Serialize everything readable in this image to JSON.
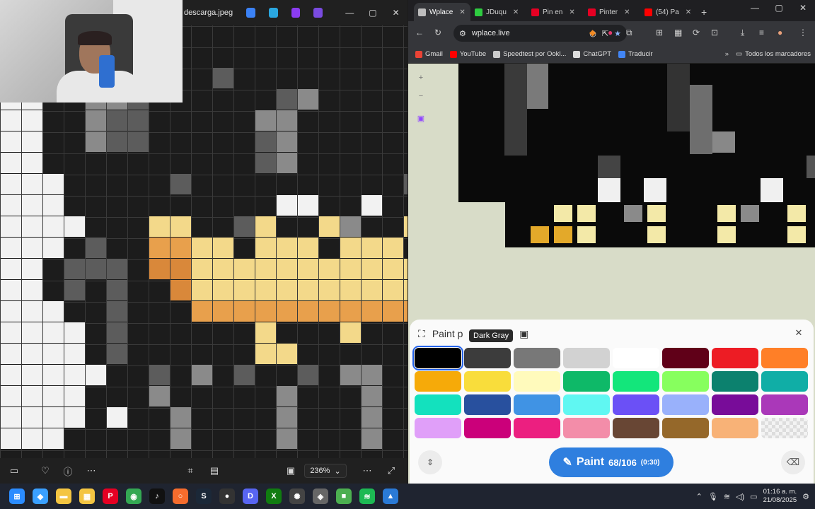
{
  "viewer": {
    "filename": "descarga.jpeg",
    "zoom": "236%",
    "toolbar_icons": [
      "film-icon",
      "heart-icon",
      "info-icon",
      "more-icon",
      "crop-icon",
      "adjust-icon",
      "fit-icon",
      "more-icon-2",
      "fullscreen-icon"
    ]
  },
  "browser": {
    "tabs": [
      {
        "label": "Wplace",
        "color": "#bdbdbd",
        "active": true
      },
      {
        "label": "JDuqu",
        "color": "#2ecc40",
        "active": false
      },
      {
        "label": "Pin en",
        "color": "#e60023",
        "active": false
      },
      {
        "label": "Pinter",
        "color": "#e60023",
        "active": false
      },
      {
        "label": "(54) Pa",
        "color": "#ff0000",
        "active": false
      }
    ],
    "url": "wplace.live",
    "bookmarks": [
      {
        "label": "Gmail",
        "color": "#ea4335"
      },
      {
        "label": "YouTube",
        "color": "#ff0000"
      },
      {
        "label": "Speedtest por Ookl...",
        "color": "#cccccc"
      },
      {
        "label": "ChatGPT",
        "color": "#dddddd"
      },
      {
        "label": "Traducir",
        "color": "#4285f4"
      }
    ],
    "bookmarks_folder": "Todos los marcadores"
  },
  "palette_panel": {
    "title": "Paint p",
    "tooltip": "Dark Gray",
    "colors": [
      "#000000",
      "#3c3c3c",
      "#787878",
      "#d2d2d2",
      "#ffffff",
      "#600018",
      "#ed1c24",
      "#ff7f27",
      "#f6aa09",
      "#f9dd3b",
      "#fffabc",
      "#0eb968",
      "#13e67b",
      "#87ff5e",
      "#0c816e",
      "#10aea6",
      "#13e1be",
      "#28509e",
      "#4093e4",
      "#60f7f2",
      "#6b50f6",
      "#99b1fb",
      "#780c99",
      "#aa38b9",
      "#e09ff9",
      "#cb007a",
      "#ec1f80",
      "#f38da9",
      "#684634",
      "#95682a",
      "#f8b277",
      "transparent"
    ],
    "selected_index": 0,
    "paint_label": "Paint",
    "paint_count": "68/106",
    "paint_time": "(0:30)"
  },
  "taskbar": {
    "apps": [
      {
        "name": "windows-start-icon",
        "color": "#2b8cff",
        "glyph": "⊞"
      },
      {
        "name": "copilot-icon",
        "color": "#3aa0ff",
        "glyph": "◆"
      },
      {
        "name": "file-explorer-icon",
        "color": "#f4c542",
        "glyph": "▬"
      },
      {
        "name": "store-icon",
        "color": "#f4c542",
        "glyph": "▦"
      },
      {
        "name": "pinterest-icon",
        "color": "#e60023",
        "glyph": "P"
      },
      {
        "name": "chrome-icon",
        "color": "#34a853",
        "glyph": "◉"
      },
      {
        "name": "tiktok-icon",
        "color": "#111111",
        "glyph": "♪"
      },
      {
        "name": "origin-icon",
        "color": "#f56c2d",
        "glyph": "○"
      },
      {
        "name": "steam-icon",
        "color": "#1b2838",
        "glyph": "S"
      },
      {
        "name": "obs-icon",
        "color": "#333333",
        "glyph": "●"
      },
      {
        "name": "discord-icon",
        "color": "#5865f2",
        "glyph": "D"
      },
      {
        "name": "xbox-icon",
        "color": "#107c10",
        "glyph": "X"
      },
      {
        "name": "chatgpt-icon",
        "color": "#444444",
        "glyph": "✺"
      },
      {
        "name": "vpn-icon",
        "color": "#666666",
        "glyph": "◈"
      },
      {
        "name": "minecraft-icon",
        "color": "#4caf50",
        "glyph": "■"
      },
      {
        "name": "spotify-icon",
        "color": "#1db954",
        "glyph": "≋"
      },
      {
        "name": "photos-icon",
        "color": "#2a7ad6",
        "glyph": "▲"
      }
    ],
    "time": "01:16 a. m.",
    "date": "21/08/2025"
  }
}
